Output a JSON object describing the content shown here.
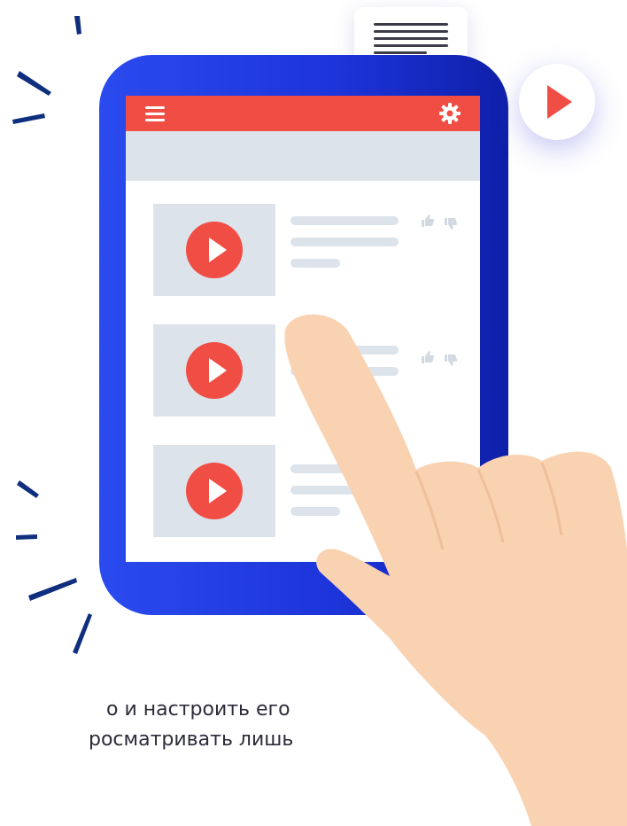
{
  "caption": {
    "line1": "о и настроить его",
    "line2": "росматривать лишь"
  },
  "colors": {
    "tablet_blue": "#1c33d8",
    "accent_red": "#f04e45",
    "placeholder_gray": "#dde3ea",
    "skin": "#f9d2b2",
    "spark_blue": "#0f2f7e"
  },
  "icons": {
    "menu": "hamburger-icon",
    "settings": "gear-icon",
    "play": "play-icon",
    "like": "thumbs-up-icon",
    "dislike": "thumbs-down-icon",
    "document": "document-icon"
  },
  "video_list": {
    "items": [
      {
        "has_reactions": true
      },
      {
        "has_reactions": true
      },
      {
        "has_reactions": false
      }
    ]
  }
}
